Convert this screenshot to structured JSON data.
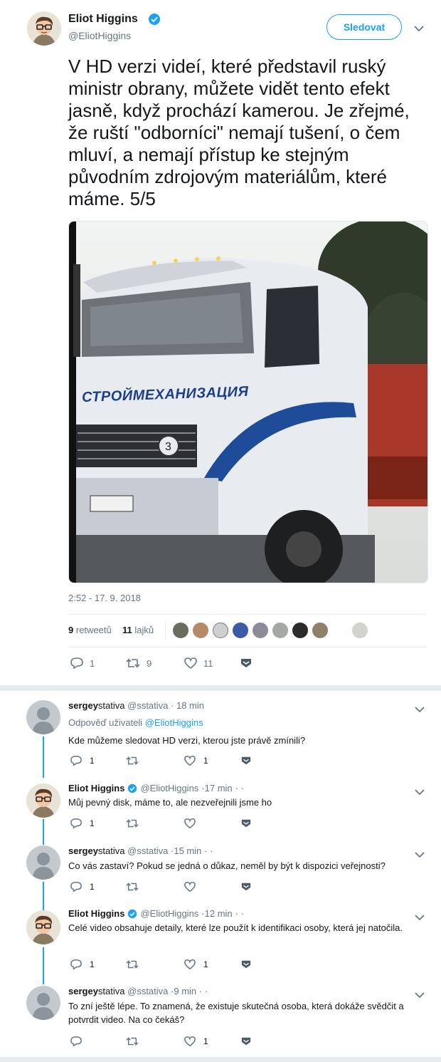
{
  "main_tweet": {
    "author_name": "Eliot Higgins",
    "author_handle": "@EliotHiggins",
    "follow_label": "Sledovat",
    "text": "V HD verzi videí, které představil ruský ministr obrany, můžete vidět tento efekt jasně, když prochází kamerou. Je zřejmé, že ruští \"odborníci\" nemají tušení, o čem mluví, a nemají přístup ke stejným původním zdrojovým materiálům, které máme. 5/5",
    "image_text": "СТРОЙМЕХАНИЗАЦИЯ",
    "timestamp": "2:52 - 17. 9. 2018",
    "retweet_count": "9",
    "retweet_label": "retweetů",
    "like_count": "11",
    "like_label": "lajků",
    "action_reply": "1",
    "action_retweet": "9",
    "action_like": "11"
  },
  "replies": [
    {
      "name": "sergey",
      "name_rest": "stativa",
      "handle": "@sstativa",
      "time": "· 18 min",
      "reply_to_prefix": "Odpověď uživateli",
      "reply_to_handle": "@EliotHiggins",
      "text": "Kde můžeme sledovat HD verzi, kterou jste právě zmínili?",
      "reply": "1",
      "retweet": "",
      "like": "1"
    },
    {
      "name": "Eliot Higgins",
      "handle": "@EliotHiggins",
      "time": "·17 min",
      "text": "Můj pevný disk, máme to, ale nezveřejnili jsme ho",
      "reply": "1",
      "retweet": "",
      "like": ""
    },
    {
      "name": "sergey",
      "name_rest": "stativa",
      "handle": "@sstativa",
      "time": "·15 min",
      "text": "Co vás zastaví? Pokud se jedná o důkaz, neměl by být k dispozici veřejnosti?",
      "reply": "1",
      "retweet": "",
      "like": ""
    },
    {
      "name": "Eliot Higgins",
      "handle": "@EliotHiggins",
      "time": "·12 min",
      "text": "Celé video obsahuje detaily, které lze použít k identifikaci osoby, která jej natočila.",
      "reply": "1",
      "retweet": "",
      "like": "1"
    },
    {
      "name": "sergey",
      "name_rest": "stativa",
      "handle": "@sstativa",
      "time": "·9 min",
      "text": "To zní ještě lépe. To znamená, že existuje skutečná osoba, která dokáže svědčit a potvrdit video. Na co čekáš?",
      "reply": "",
      "retweet": "",
      "like": "1"
    }
  ]
}
